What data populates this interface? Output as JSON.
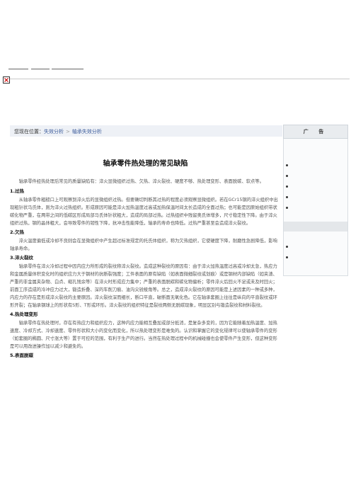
{
  "breadcrumb": {
    "prefix": "您现在位置：",
    "items": [
      "失效分析",
      "轴承失效分析"
    ],
    "separator": ">"
  },
  "sidebar": {
    "title": "广 告"
  },
  "article": {
    "title": "轴承零件热处理的常见缺陷",
    "intro": "轴承零件经热处理后常见的质量缺陷有：淬火显微组织过热、欠热、淬火裂纹、硬度不够、热处理变形、表面脱碳、软点等。",
    "sections": [
      {
        "heading": "1.过热",
        "body": "从轴承零件粗糙口上可观察到淬火后的显微组织过热。但要确切判断其过热的程度必须观察显微组织。若在GCr15钢的淬火组织中出现粗针状马氏体，则为淬火过热组织。形成原因可能是淬火加热温度过高或加热保温时间太长造成的全面过热；也可能是因原始组织带状碳化物严重，在两带之间的低碳区形成局部马氏体针状粗大，造成的局部过热。过热组织中残留奥氏体增多，尺寸稳定性下降。由于淬火组织过热，钢的晶体粗大，会导致零件的韧性下降，抗冲击性能降低，轴承的寿命也降低。过热严重甚至会造成淬火裂纹。"
      },
      {
        "heading": "2.欠热",
        "body": "淬火温度偏低或冷却不良则会在显微组织中产生超过标准规定的托氏体组织，称为欠热组织，它使硬度下降，耐磨性急剧降低，影响轴承寿命。"
      },
      {
        "heading": "3.淬火裂纹",
        "body": "轴承零件在淬火冷却过程中因内应力所形成的裂纹称淬火裂纹。造成这种裂纹的原因有：由于淬火加热温度过高或冷却太急，热应力和金属质量体积变化时的组织应力大于钢材的抗断裂强度；工件表面的原有缺陷（如表面微细裂纹或划痕）或是钢材内部缺陷（如夹渣、严重的非金属夹杂物、白点、缩孔残余等）在淬火时形成应力集中；严重的表面脱碳和碳化物偏析；零件淬火后回火不足或未及时回火；前面工序造成的冷冲应力过大，锻造折叠、深的车削刀痕、油沟尖锐棱角等。总之，造成淬火裂纹的原因可能是上述因素的一种或多种，内应力的存在是形成淬火裂纹的主要原因。淬火裂纹深而细长，断口平直，破断面无氧化色。它在轴承套圈上往往是纵向的平直裂纹或环形开裂；在轴承钢球上的形状有S形、T形或环形。淬火裂纹的组织特征是裂纹两侧无脱碳现象，明显区别与锻造裂纹和材料裂纹。"
      },
      {
        "heading": "4.热处理变形",
        "body": "轴承零件在热处理时，存在有热应力和组织应力，这种内应力能相互叠加或部分抵消，是复杂多变的，因为它能随着加热温度、加热速度、冷却方式、冷却速度、零件形状和大小的变化而变化，所以热处理变形是难免的。认识和掌握它的变化规律可以使轴承零件的变形（如套圈的椭圆、尺寸涨大等）置于可控的范围，有利于生产的进行。当然在热处理过程中的机械碰撞也会使零件产生变形，但这种变形是可以用改进操作加以减少和避免的。"
      },
      {
        "heading": "5.表面脱碳",
        "body": ""
      }
    ]
  }
}
